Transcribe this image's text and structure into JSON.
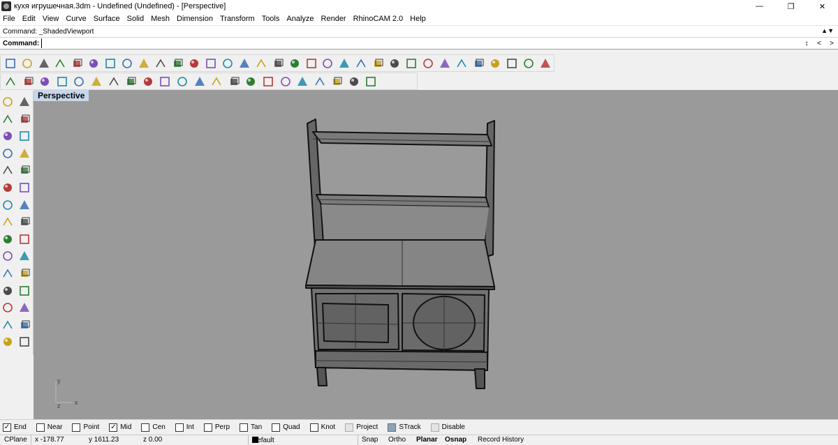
{
  "window": {
    "title": "кухя игрушечная.3dm - Undefined (Undefined) - [Perspective]",
    "controls": [
      "minimize-icon",
      "restore-icon",
      "close-icon"
    ]
  },
  "menu": [
    "File",
    "Edit",
    "View",
    "Curve",
    "Surface",
    "Solid",
    "Mesh",
    "Dimension",
    "Transform",
    "Tools",
    "Analyze",
    "Render",
    "RhinoCAM 2.0",
    "Help"
  ],
  "command": {
    "history": "Command: _ShadedViewport",
    "prompt": "Command:",
    "value": ""
  },
  "toolbar_top": [
    "new-icon",
    "open-icon",
    "save-icon",
    "print-icon",
    "import-icon",
    "cut-icon",
    "copy-icon",
    "paste-icon",
    "undo-icon",
    "pan-hand-icon",
    "rotate-view-icon",
    "zoom-icon",
    "zoom-window-icon",
    "zoom-extents-icon",
    "zoom-selected-icon",
    "rotate-camera-icon",
    "four-viewports-icon",
    "car-render-icon",
    "grid-plane-icon",
    "point-icon",
    "cplane-icon",
    "layer-icon",
    "light-bulb-icon",
    "lock-icon",
    "material-icon",
    "color-wheel-icon",
    "shaded-sphere-icon",
    "wireframe-sphere-icon",
    "render-sphere-icon",
    "pencil-icon",
    "settings-icon",
    "options-icon",
    "help-icon"
  ],
  "toolbar_second": [
    "grid-snap-icon",
    "origin-axes-icon",
    "block-icon",
    "dimension-icon",
    "solid-box-icon",
    "split-icon",
    "extrude-icon",
    "unroll-icon",
    "point-cloud-icon",
    "transform-icon",
    "mesh-grid-icon",
    "extract-icon",
    "sweep-icon",
    "ruler-icon",
    "mirror-icon",
    "trim-icon",
    "offset-icon",
    "taper-icon",
    "chamfer-icon",
    "fillet-icon",
    "wave-icon",
    "render-tool-icon"
  ],
  "left_tools": [
    "select-arrow-icon",
    "point-icon",
    "polyline-icon",
    "curve-icon",
    "circle-icon",
    "ellipse-icon",
    "arc-icon",
    "rectangle-icon",
    "polygon-icon",
    "freeform-icon",
    "surface-icon",
    "loft-icon",
    "box-solid-icon",
    "boolean-icon",
    "cylinder-icon",
    "mesh-icon",
    "settings-gear-icon",
    "explode-icon",
    "group-icon",
    "dimension-icon",
    "nodes-icon",
    "scatter-icon",
    "bend-icon",
    "twist-icon",
    "text-t-icon",
    "array-icon",
    "array-grid-icon",
    "taper-tool-icon",
    "cube-icon",
    "hatch-icon"
  ],
  "viewport": {
    "name": "Perspective",
    "axis_labels": {
      "y": "y",
      "x": "x",
      "z": "z"
    }
  },
  "osnaps": [
    {
      "label": "End",
      "checked": true
    },
    {
      "label": "Near",
      "checked": false
    },
    {
      "label": "Point",
      "checked": false
    },
    {
      "label": "Mid",
      "checked": true
    },
    {
      "label": "Cen",
      "checked": false
    },
    {
      "label": "Int",
      "checked": false
    },
    {
      "label": "Perp",
      "checked": false
    },
    {
      "label": "Tan",
      "checked": false
    },
    {
      "label": "Quad",
      "checked": false
    },
    {
      "label": "Knot",
      "checked": false
    },
    {
      "label": "Project",
      "checked": false,
      "disabled": true
    },
    {
      "label": "STrack",
      "checked": false,
      "strack": true
    },
    {
      "label": "Disable",
      "checked": false,
      "disabled": true
    }
  ],
  "status": {
    "cplane": "CPlane",
    "x": "x -178.77",
    "y": "y 1611.23",
    "z": "z 0.00",
    "layer": "Default",
    "snap": "Snap",
    "ortho": "Ortho",
    "planar": "Planar",
    "osnap": "Osnap",
    "record_history": "Record History"
  },
  "colors": {
    "viewport_bg": "#9a9a9a",
    "model_fill": "#6e6e6e",
    "model_edge": "#111111",
    "tab_active": "#c7d6ea"
  }
}
